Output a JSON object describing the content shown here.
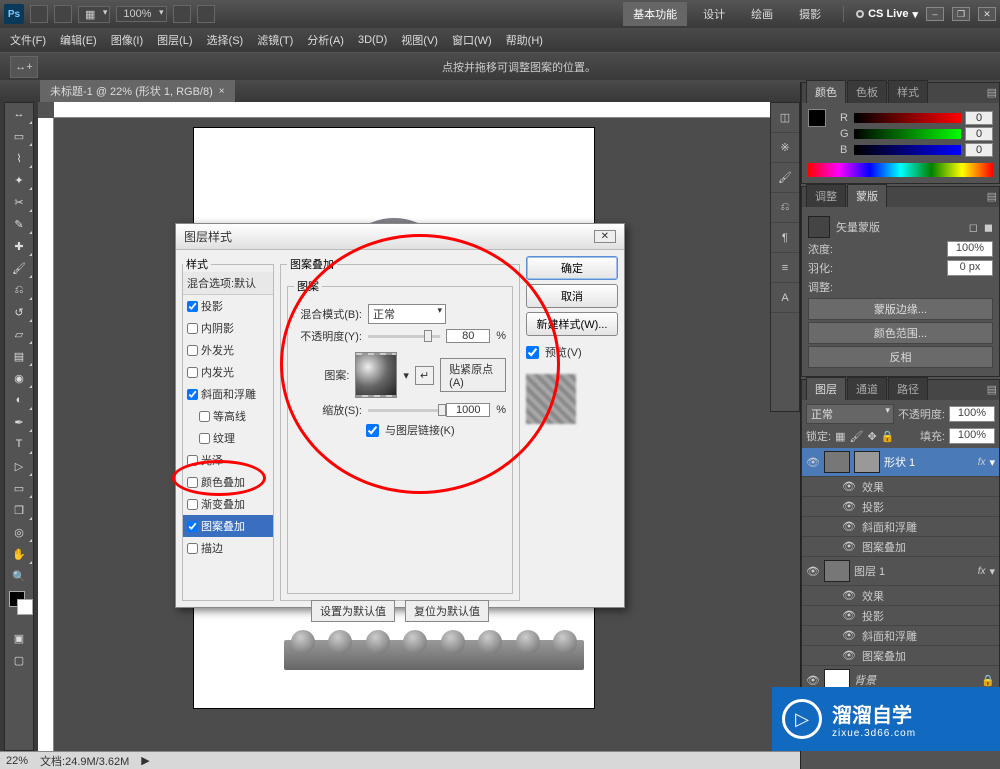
{
  "app": {
    "logo": "Ps",
    "zoom_dd": "100%",
    "cslive": "CS Live"
  },
  "workspaces": {
    "basic": "基本功能",
    "design": "设计",
    "paint": "绘画",
    "photo": "摄影"
  },
  "winctl": {
    "min": "–",
    "max": "❐",
    "close": "✕"
  },
  "menu": {
    "file": "文件(F)",
    "edit": "编辑(E)",
    "image": "图像(I)",
    "layer": "图层(L)",
    "select": "选择(S)",
    "filter": "滤镜(T)",
    "analysis": "分析(A)",
    "threeD": "3D(D)",
    "view": "视图(V)",
    "window": "窗口(W)",
    "help": "帮助(H)"
  },
  "optbar": {
    "hint": "点按并拖移可调整图案的位置。"
  },
  "doctab": {
    "name": "未标题-1 @ 22% (形状 1, RGB/8)",
    "close": "×"
  },
  "statusbar": {
    "zoom": "22%",
    "doc": "文档:24.9M/3.62M",
    "arrow": "▶"
  },
  "color_panel": {
    "tabs": {
      "color": "颜色",
      "swatches": "色板",
      "styles": "样式"
    },
    "r": {
      "lbl": "R",
      "val": "0"
    },
    "g": {
      "lbl": "G",
      "val": "0"
    },
    "b": {
      "lbl": "B",
      "val": "0"
    }
  },
  "adjust_panel": {
    "tabs": {
      "adjust": "调整",
      "mask": "蒙版"
    },
    "label": "矢量蒙版",
    "density": {
      "lbl": "浓度:",
      "val": "100%"
    },
    "feather": {
      "lbl": "羽化:",
      "val": "0 px"
    },
    "adj_lbl": "调整:",
    "mask_edge": "蒙版边缘...",
    "color_range": "颜色范围...",
    "invert": "反相"
  },
  "layers_panel": {
    "tabs": {
      "layers": "图层",
      "channels": "通道",
      "paths": "路径"
    },
    "blend": "正常",
    "opacity_lbl": "不透明度:",
    "opacity": "100%",
    "lock_lbl": "锁定:",
    "fill_lbl": "填充:",
    "fill": "100%",
    "l1": "形状 1",
    "l2": "图层 1",
    "bg": "背景",
    "fx": "fx",
    "effects": "效果",
    "shadow": "投影",
    "bevel": "斜面和浮雕",
    "pattern": "图案叠加",
    "unlock": "▾",
    "lock_ico": "🔒"
  },
  "dialog": {
    "title": "图层样式",
    "styles_hdr": "样式",
    "blend_opts": "混合选项:默认",
    "items": {
      "shadow": "投影",
      "inner_shadow": "内阴影",
      "outer_glow": "外发光",
      "inner_glow": "内发光",
      "bevel": "斜面和浮雕",
      "contour": "等高线",
      "texture": "纹理",
      "satin": "光泽",
      "color_overlay": "颜色叠加",
      "grad_overlay": "渐变叠加",
      "pattern_overlay": "图案叠加",
      "stroke": "描边"
    },
    "section": "图案叠加",
    "inner_section": "图案",
    "blend_mode_lbl": "混合模式(B):",
    "blend_mode": "正常",
    "opacity_lbl": "不透明度(Y):",
    "opacity": "80",
    "pct": "%",
    "pattern_lbl": "图案:",
    "snap_btn": "贴紧原点(A)",
    "scale_lbl": "缩放(S):",
    "scale": "1000",
    "link_lbl": "与图层链接(K)",
    "reset_default": "设置为默认值",
    "restore_default": "复位为默认值",
    "ok": "确定",
    "cancel": "取消",
    "new_style": "新建样式(W)...",
    "preview_lbl": "预览(V)",
    "close_x": "✕",
    "dd_arrow": "▾",
    "snap_ico": "↵"
  },
  "watermark": {
    "big": "溜溜自学",
    "sm": "zixue.3d66.com",
    "play": "▷"
  }
}
